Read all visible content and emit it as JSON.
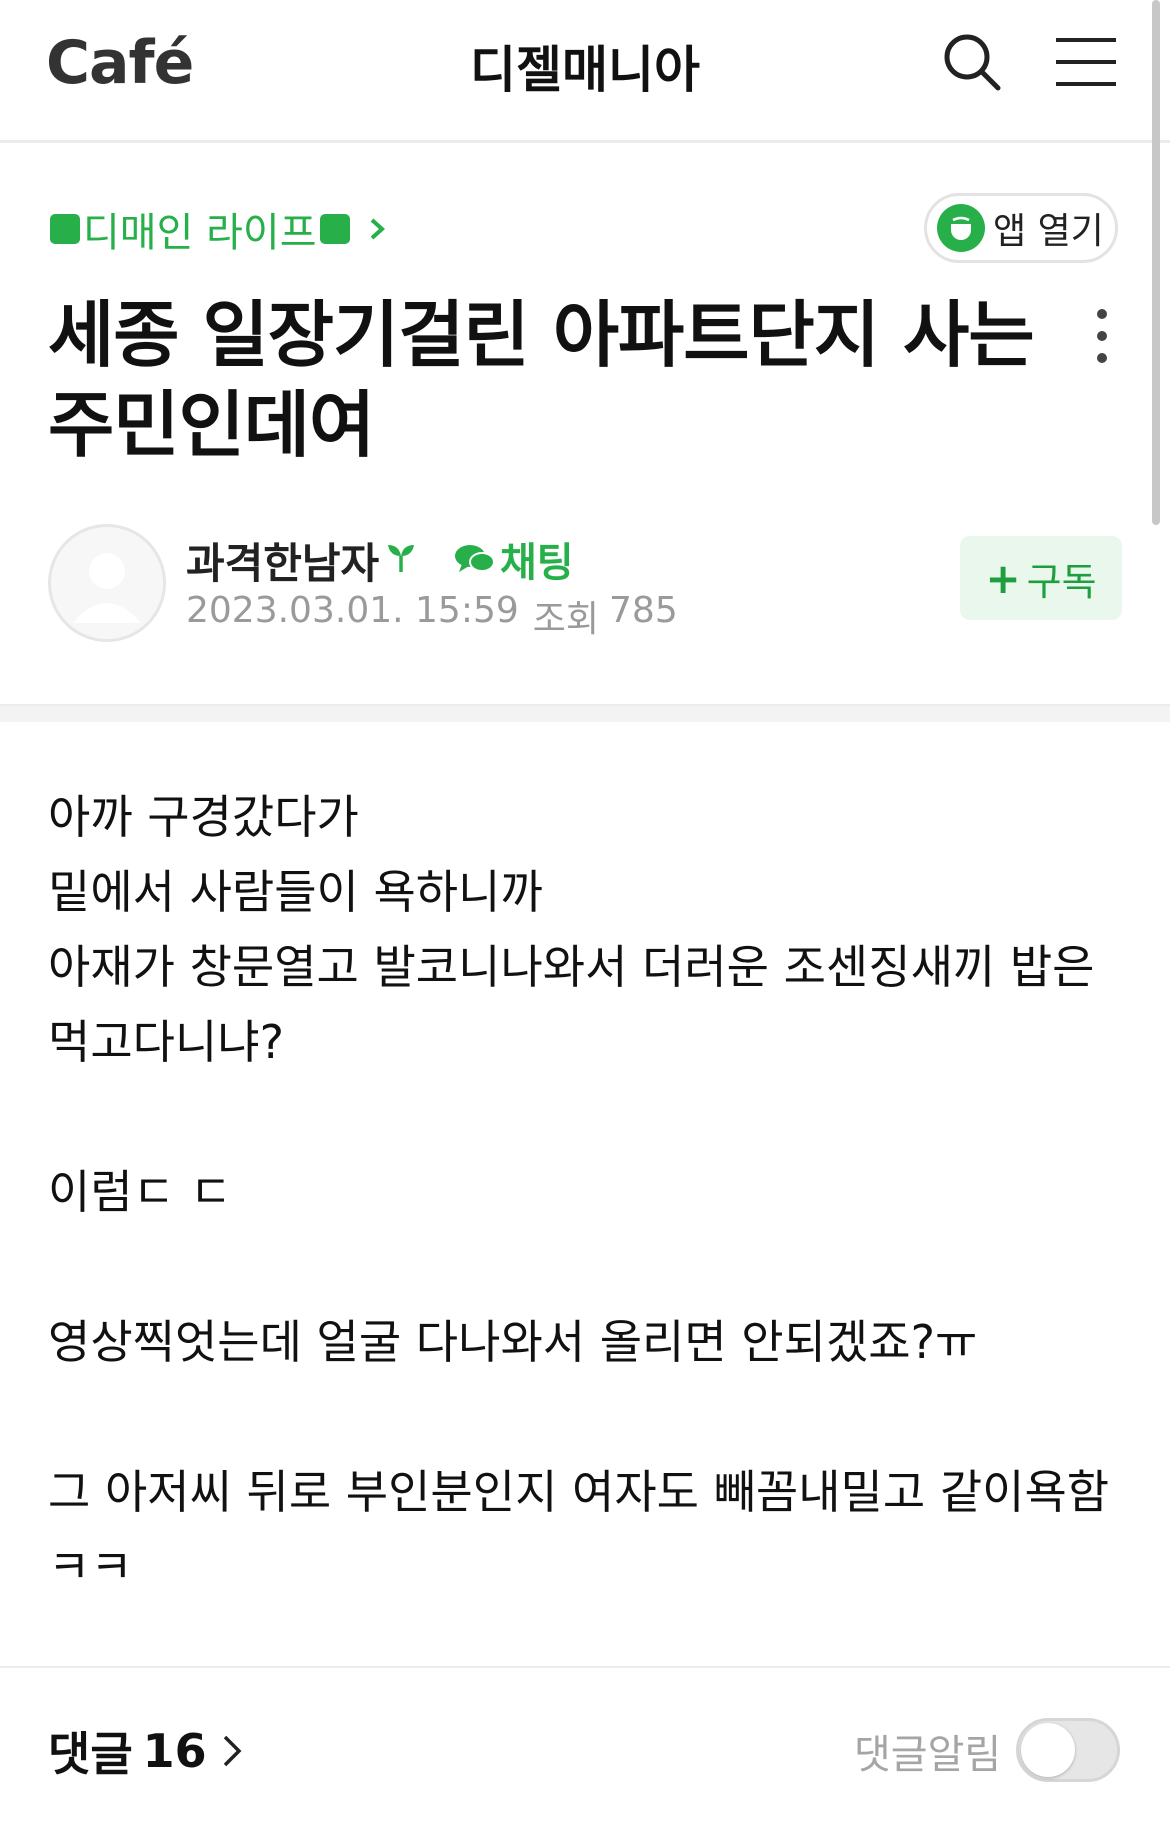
{
  "header": {
    "logo_text": "Café",
    "cafe_name": "디젤매니아"
  },
  "board": {
    "name": "디매인 라이프"
  },
  "app_open_label": "앱 열기",
  "post": {
    "title": "세종 일장기걸린 아파트단지 사는주민인데여",
    "author": "과격한남자",
    "chat_label": "채팅",
    "date": "2023.03.01. 15:59",
    "views_label": "조회",
    "views": "785",
    "subscribe_label": "구독",
    "body": [
      "아까 구경갔다가",
      "밑에서 사람들이 욕하니까",
      "아재가 창문열고 발코니나와서 더러운 조센징새끼 밥은먹고다니냐?",
      "",
      "이럼ㄷ ㄷ",
      "",
      "영상찍엇는데 얼굴 다나와서 올리면 안되겠죠?ㅠ",
      "",
      "그 아저씨 뒤로 부인분인지 여자도 빼꼼내밀고 같이욕함ㅋㅋ"
    ]
  },
  "footer": {
    "comments_label": "댓글",
    "comments_count": "16",
    "alert_label": "댓글알림",
    "alert_on": false
  },
  "colors": {
    "accent": "#27b04a",
    "subscribe_bg": "#e9f7ec",
    "meta_gray": "#9a9a9a"
  }
}
